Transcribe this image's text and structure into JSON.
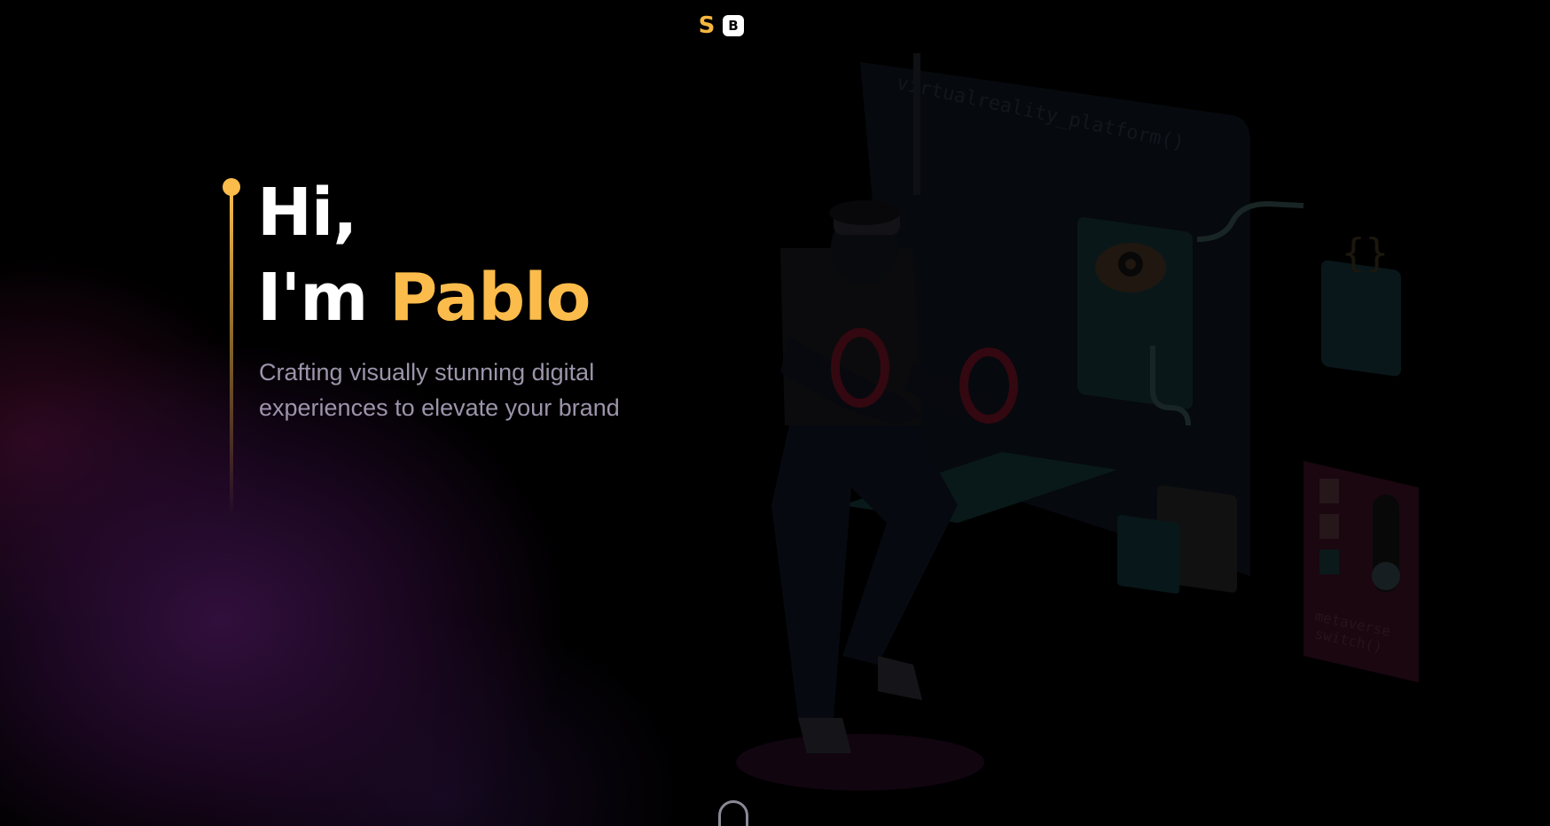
{
  "header": {
    "logo_letters": [
      "S",
      "B"
    ]
  },
  "hero": {
    "headline_line1": "Hi,",
    "headline_line2_prefix": "I'm ",
    "name": "Pablo",
    "tagline": "Crafting visually stunning digital experiences to elevate your brand"
  },
  "illustration": {
    "code_label": "virtualreality_platform()",
    "braces_label": "{}",
    "switch_label_line1": "metaverse",
    "switch_label_line2": "switch()"
  },
  "icons": {
    "logo": "sb-logo-icon",
    "cloud_gear": "cloud-gear-icon",
    "scroll": "mouse-scroll-icon"
  },
  "colors": {
    "accent": "#fbbc4b",
    "background": "#000000",
    "tagline": "#9d94ab",
    "glow": "#2a0f3a"
  }
}
